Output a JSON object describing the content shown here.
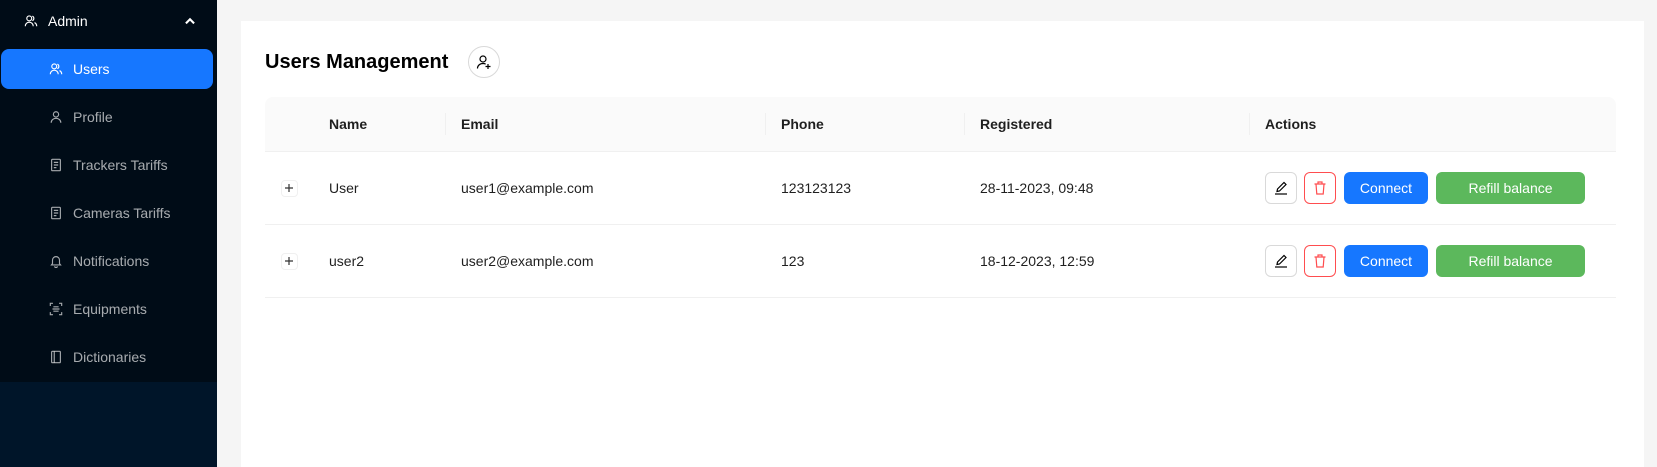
{
  "sidebar": {
    "group": {
      "label": "Admin",
      "icon": "users-icon",
      "expanded": true
    },
    "items": [
      {
        "label": "Users",
        "icon": "users-icon",
        "active": true
      },
      {
        "label": "Profile",
        "icon": "user-icon"
      },
      {
        "label": "Trackers Tariffs",
        "icon": "file-text-icon"
      },
      {
        "label": "Cameras Tariffs",
        "icon": "file-text-icon"
      },
      {
        "label": "Notifications",
        "icon": "bell-icon"
      },
      {
        "label": "Equipments",
        "icon": "scan-icon"
      },
      {
        "label": "Dictionaries",
        "icon": "book-icon"
      }
    ],
    "colors": {
      "background": "#001529",
      "submenu": "#000c17",
      "active": "#1677ff"
    }
  },
  "main": {
    "title": "Users Management",
    "add_user_icon": "user-add-icon",
    "table": {
      "columns": [
        "Name",
        "Email",
        "Phone",
        "Registered",
        "Actions"
      ],
      "rows": [
        {
          "name": "User",
          "email": "user1@example.com",
          "phone": "123123123",
          "registered": "28-11-2023, 09:48"
        },
        {
          "name": "user2",
          "email": "user2@example.com",
          "phone": "123",
          "registered": "18-12-2023, 12:59"
        }
      ],
      "actions": {
        "edit_icon": "edit-icon",
        "delete_icon": "delete-icon",
        "connect_label": "Connect",
        "refill_label": "Refill balance"
      }
    },
    "colors": {
      "primary": "#1677ff",
      "success": "#5cb85c",
      "danger": "#ff4d4f"
    }
  }
}
